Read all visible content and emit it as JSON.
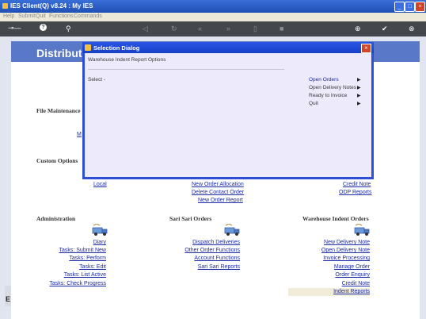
{
  "window": {
    "title": "IES Client(Q) v8.24 : My IES"
  },
  "menu": [
    "Help",
    "Submit",
    "Quit",
    "Functions",
    "Commands"
  ],
  "banner": {
    "title": "Distributio"
  },
  "sections": {
    "file_maintenance": "File Maintenance",
    "custom_options": "Custom Options",
    "administration": "Administration",
    "sari_sari": "Sari Sari Orders",
    "warehouse": "Warehouse Indent Orders"
  },
  "partial": {
    "m_link": "M"
  },
  "custom_links": {
    "local": "Local",
    "new_order_allocation": "New Order Allocation",
    "delete_contact_order": "Delete Contact Order",
    "new_order_report": "New Order Report",
    "credit_note": "Credit Note",
    "odp_reports": "ODP Reports"
  },
  "admin_links": [
    "Diary",
    "Tasks: Submit New",
    "Tasks: Perform",
    "Tasks: Edit",
    "Tasks: List Active",
    "Tasks: Check Progress"
  ],
  "sari_links": [
    "Dispatch Deliveries",
    "Other Order Functions",
    "Account Functions",
    "Sari Sari Reports"
  ],
  "warehouse_links": [
    "New Delivery Note",
    "Open Delivery Note",
    "Invoice Processing",
    "Manage Order",
    "Order Enquiry",
    "Credit Note",
    "Indent Reports"
  ],
  "dialog": {
    "title": "Selection Dialog",
    "subtitle": "Warehouse Indent Report Options",
    "select_label": "Select -",
    "options": [
      "Open Orders",
      "Open Delivery Notes",
      "Ready to Invoice",
      "Quit"
    ]
  },
  "bottom_left_letter": "E"
}
